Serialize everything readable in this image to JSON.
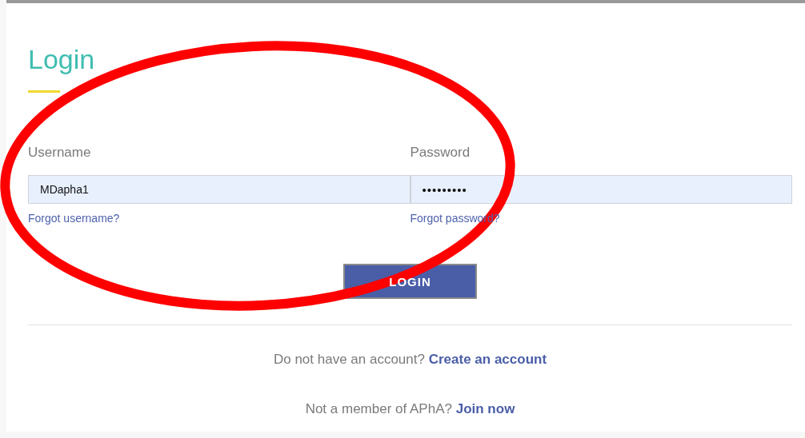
{
  "title": "Login",
  "fields": [
    {
      "label": "Username",
      "value": "MDapha1",
      "kind": "text",
      "link": "Forgot username?"
    },
    {
      "label": "Password",
      "value": "•••••••••",
      "kind": "password",
      "link": "Forgot password?"
    }
  ],
  "button": "LOGIN",
  "prompts": [
    {
      "text": "Do not have an account?",
      "link": "Create an account"
    },
    {
      "text": "Not a member of APhA?",
      "link": "Join now"
    }
  ],
  "annotation": {
    "kind": "ellipse"
  }
}
